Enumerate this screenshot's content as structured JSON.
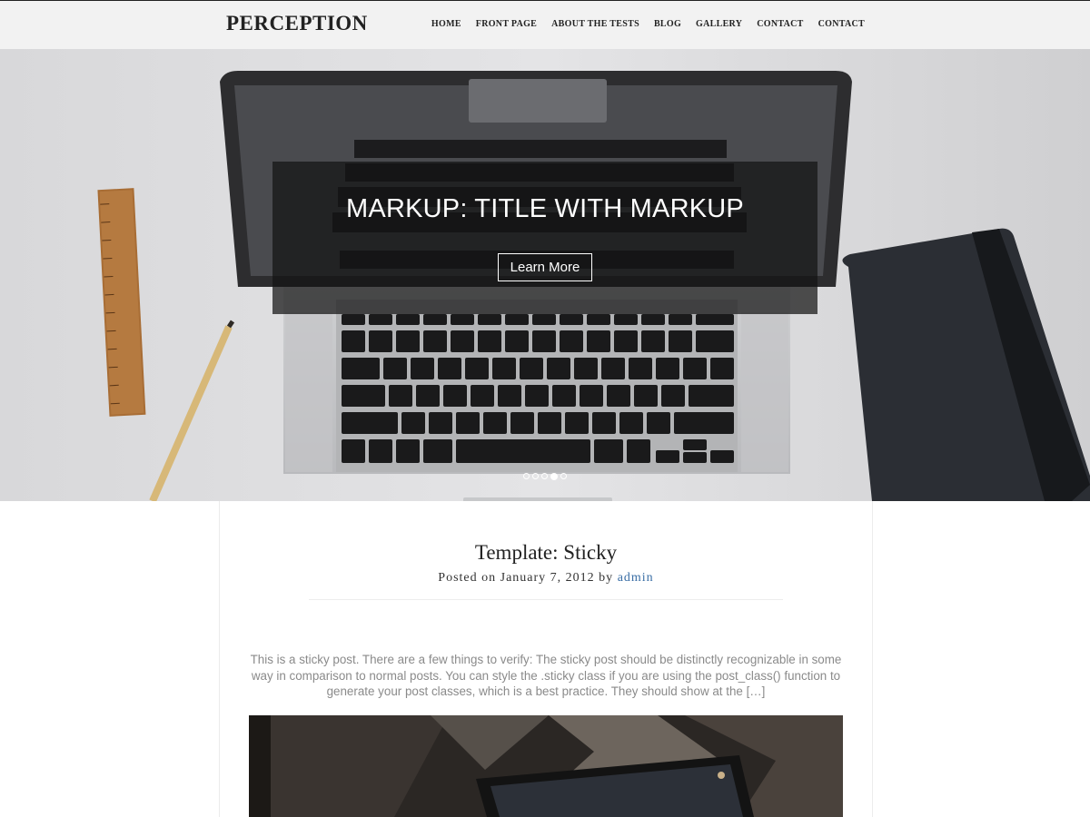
{
  "header": {
    "site_title": "PERCEPTION",
    "nav": [
      "HOME",
      "FRONT PAGE",
      "ABOUT THE TESTS",
      "BLOG",
      "GALLERY",
      "CONTACT",
      "CONTACT"
    ]
  },
  "hero": {
    "slide_title": "MARKUP: TITLE WITH MARKUP",
    "button_label": "Learn More",
    "dots_count": 5,
    "active_dot": 4
  },
  "post": {
    "title": "Template: Sticky",
    "meta_prefix": "Posted on January 7, 2012 by",
    "author": "admin",
    "excerpt": "This is a sticky post. There are a few things to verify: The sticky post should be distinctly recognizable in some way in comparison to normal posts. You can style the .sticky class if you are using the post_class() function to generate your post classes, which is a best practice. They should show at the […]"
  },
  "colors": {
    "header_bg": "#f2f2f2",
    "caption_bg": "rgba(20,20,20,0.72)",
    "author_link": "#3a6ea5",
    "excerpt_text": "#8a8a8a"
  },
  "icons": [
    "laptop-image",
    "ruler-image",
    "pencil-image",
    "notebook-image"
  ]
}
